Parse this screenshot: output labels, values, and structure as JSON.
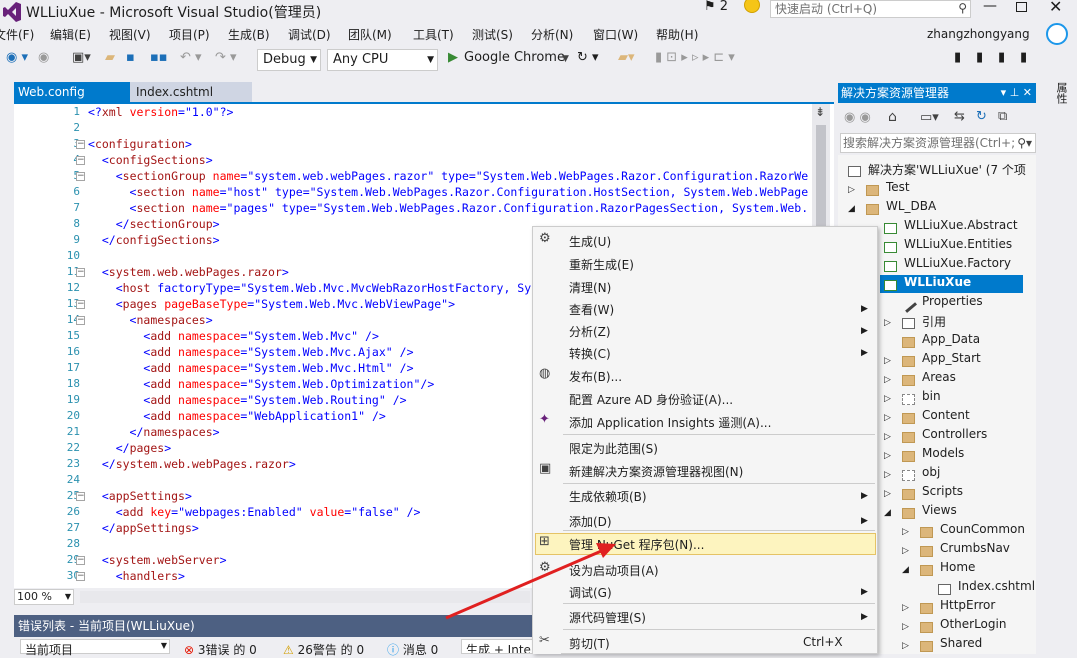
{
  "window": {
    "title": "WLLiuXue - Microsoft Visual Studio(管理员)",
    "notifications": "2",
    "quick_launch_placeholder": "快速启动 (Ctrl+Q)",
    "user": "zhangzhongyang"
  },
  "menu": [
    "文件(F)",
    "编辑(E)",
    "视图(V)",
    "项目(P)",
    "生成(B)",
    "调试(D)",
    "团队(M)",
    "工具(T)",
    "测试(S)",
    "分析(N)",
    "窗口(W)",
    "帮助(H)"
  ],
  "toolbar": {
    "config": "Debug",
    "platform": "Any CPU",
    "run_target": "Google Chrome"
  },
  "tabs": [
    {
      "label": "Web.config",
      "active": true
    },
    {
      "label": "Index.cshtml",
      "active": false
    }
  ],
  "editor": {
    "zoom": "100 %",
    "lines": [
      {
        "n": "1",
        "text": "<?xml version=\"1.0\"?>"
      },
      {
        "n": "2",
        "text": ""
      },
      {
        "n": "3",
        "text": "<configuration>"
      },
      {
        "n": "4",
        "text": "  <configSections>"
      },
      {
        "n": "5",
        "text": "    <sectionGroup name=\"system.web.webPages.razor\" type=\"System.Web.WebPages.Razor.Configuration.RazorWe"
      },
      {
        "n": "6",
        "text": "      <section name=\"host\" type=\"System.Web.WebPages.Razor.Configuration.HostSection, System.Web.WebPage"
      },
      {
        "n": "7",
        "text": "      <section name=\"pages\" type=\"System.Web.WebPages.Razor.Configuration.RazorPagesSection, System.Web."
      },
      {
        "n": "8",
        "text": "    </sectionGroup>"
      },
      {
        "n": "9",
        "text": "  </configSections>"
      },
      {
        "n": "10",
        "text": ""
      },
      {
        "n": "11",
        "text": "  <system.web.webPages.razor>"
      },
      {
        "n": "12",
        "text": "    <host factoryType=\"System.Web.Mvc.MvcWebRazorHostFactory, Sy"
      },
      {
        "n": "13",
        "text": "    <pages pageBaseType=\"System.Web.Mvc.WebViewPage\">"
      },
      {
        "n": "14",
        "text": "      <namespaces>"
      },
      {
        "n": "15",
        "text": "        <add namespace=\"System.Web.Mvc\" />"
      },
      {
        "n": "16",
        "text": "        <add namespace=\"System.Web.Mvc.Ajax\" />"
      },
      {
        "n": "17",
        "text": "        <add namespace=\"System.Web.Mvc.Html\" />"
      },
      {
        "n": "18",
        "text": "        <add namespace=\"System.Web.Optimization\"/>"
      },
      {
        "n": "19",
        "text": "        <add namespace=\"System.Web.Routing\" />"
      },
      {
        "n": "20",
        "text": "        <add namespace=\"WebApplication1\" />"
      },
      {
        "n": "21",
        "text": "      </namespaces>"
      },
      {
        "n": "22",
        "text": "    </pages>"
      },
      {
        "n": "23",
        "text": "  </system.web.webPages.razor>"
      },
      {
        "n": "24",
        "text": ""
      },
      {
        "n": "25",
        "text": "  <appSettings>"
      },
      {
        "n": "26",
        "text": "    <add key=\"webpages:Enabled\" value=\"false\" />"
      },
      {
        "n": "27",
        "text": "  </appSettings>"
      },
      {
        "n": "28",
        "text": ""
      },
      {
        "n": "29",
        "text": "  <system.webServer>"
      },
      {
        "n": "30",
        "text": "    <handlers>"
      }
    ]
  },
  "error_list": {
    "title": "错误列表 - 当前项目(WLLiuXue)",
    "scope": "当前项目",
    "errors": "3错误 的 0",
    "warnings": "26警告 的 0",
    "messages": "消息 0",
    "build": "生成 + Intel"
  },
  "solution_explorer": {
    "title": "解决方案资源管理器",
    "search_placeholder": "搜索解决方案资源管理器(Ctrl+;",
    "nodes": [
      {
        "label": "解决方案'WLLiuXue' (7 个项",
        "icon": "solution-icon"
      },
      {
        "label": "Test",
        "icon": "folder-icon"
      },
      {
        "label": "WL_DBA",
        "icon": "folder-open-icon"
      },
      {
        "label": "WLLiuXue.Abstract",
        "icon": "csproj-icon"
      },
      {
        "label": "WLLiuXue.Entities",
        "icon": "csproj-icon"
      },
      {
        "label": "WLLiuXue.Factory",
        "icon": "csproj-icon"
      },
      {
        "label": "WLLiuXue",
        "icon": "web-project-icon"
      },
      {
        "label": "Properties",
        "icon": "wrench-icon"
      },
      {
        "label": "引用",
        "icon": "references-icon"
      },
      {
        "label": "App_Data",
        "icon": "folder-icon"
      },
      {
        "label": "App_Start",
        "icon": "folder-icon"
      },
      {
        "label": "Areas",
        "icon": "folder-icon"
      },
      {
        "label": "bin",
        "icon": "folder-dashed-icon"
      },
      {
        "label": "Content",
        "icon": "folder-icon"
      },
      {
        "label": "Controllers",
        "icon": "folder-icon"
      },
      {
        "label": "Models",
        "icon": "folder-icon"
      },
      {
        "label": "obj",
        "icon": "folder-dashed-icon"
      },
      {
        "label": "Scripts",
        "icon": "folder-icon"
      },
      {
        "label": "Views",
        "icon": "folder-open-icon"
      },
      {
        "label": "CounCommon",
        "icon": "folder-icon"
      },
      {
        "label": "CrumbsNav",
        "icon": "folder-icon"
      },
      {
        "label": "Home",
        "icon": "folder-open-icon"
      },
      {
        "label": "Index.cshtml",
        "icon": "razor-file-icon"
      },
      {
        "label": "HttpError",
        "icon": "folder-icon"
      },
      {
        "label": "OtherLogin",
        "icon": "folder-icon"
      },
      {
        "label": "Shared",
        "icon": "folder-icon"
      }
    ]
  },
  "context_menu": {
    "items": [
      {
        "label": "生成(U)",
        "icon": "build-icon"
      },
      {
        "label": "重新生成(E)"
      },
      {
        "label": "清理(N)"
      },
      {
        "label": "查看(W)",
        "submenu": true
      },
      {
        "label": "分析(Z)",
        "submenu": true
      },
      {
        "label": "转换(C)",
        "submenu": true
      },
      {
        "label": "发布(B)...",
        "icon": "globe-icon"
      },
      {
        "label": "配置 Azure AD 身份验证(A)..."
      },
      {
        "label": "添加 Application Insights 遥测(A)...",
        "icon": "bulb-icon"
      },
      {
        "label": "限定为此范围(S)"
      },
      {
        "label": "新建解决方案资源管理器视图(N)",
        "icon": "window-icon"
      },
      {
        "label": "生成依赖项(B)",
        "submenu": true
      },
      {
        "label": "添加(D)",
        "submenu": true
      },
      {
        "label": "管理 NuGet 程序包(N)...",
        "icon": "package-icon",
        "highlighted": true
      },
      {
        "label": "设为启动项目(A)",
        "icon": "gear-icon"
      },
      {
        "label": "调试(G)",
        "submenu": true
      },
      {
        "label": "源代码管理(S)",
        "submenu": true
      },
      {
        "label": "剪切(T)",
        "icon": "scissors-icon",
        "shortcut": "Ctrl+X"
      }
    ]
  },
  "colors": {
    "accent": "#007acc",
    "highlight": "#fdf4bf",
    "annotation_arrow": "#e02020"
  }
}
